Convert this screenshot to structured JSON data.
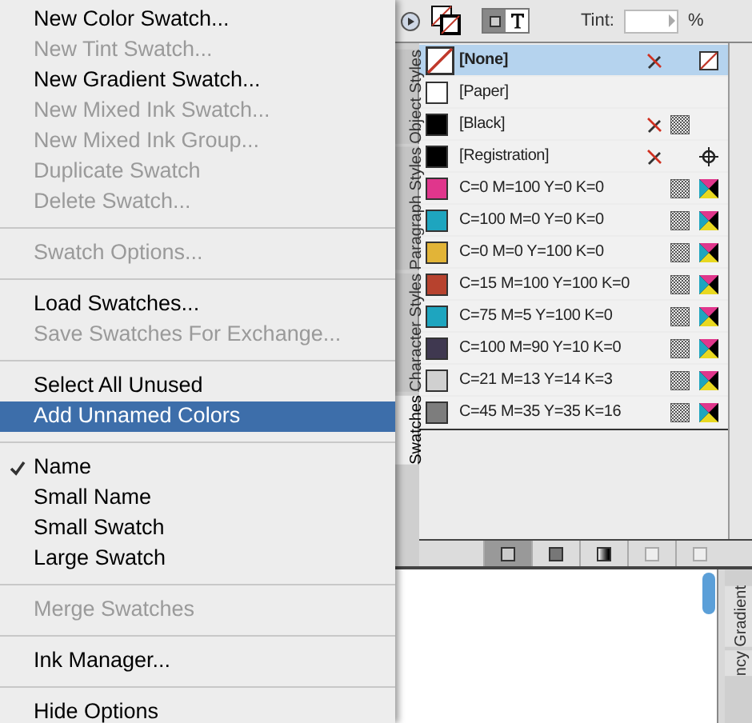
{
  "menu": {
    "sections": [
      [
        {
          "label": "New Color Swatch...",
          "disabled": false,
          "selected": false,
          "checked": false
        },
        {
          "label": "New Tint Swatch...",
          "disabled": true,
          "selected": false,
          "checked": false
        },
        {
          "label": "New Gradient Swatch...",
          "disabled": false,
          "selected": false,
          "checked": false
        },
        {
          "label": "New Mixed Ink Swatch...",
          "disabled": true,
          "selected": false,
          "checked": false
        },
        {
          "label": "New Mixed Ink Group...",
          "disabled": true,
          "selected": false,
          "checked": false
        },
        {
          "label": "Duplicate Swatch",
          "disabled": true,
          "selected": false,
          "checked": false
        },
        {
          "label": "Delete Swatch...",
          "disabled": true,
          "selected": false,
          "checked": false
        }
      ],
      [
        {
          "label": "Swatch Options...",
          "disabled": true,
          "selected": false,
          "checked": false
        }
      ],
      [
        {
          "label": "Load Swatches...",
          "disabled": false,
          "selected": false,
          "checked": false
        },
        {
          "label": "Save Swatches For Exchange...",
          "disabled": true,
          "selected": false,
          "checked": false
        }
      ],
      [
        {
          "label": "Select All Unused",
          "disabled": false,
          "selected": false,
          "checked": false
        },
        {
          "label": "Add Unnamed Colors",
          "disabled": false,
          "selected": true,
          "checked": false
        }
      ],
      [
        {
          "label": "Name",
          "disabled": false,
          "selected": false,
          "checked": true
        },
        {
          "label": "Small Name",
          "disabled": false,
          "selected": false,
          "checked": false
        },
        {
          "label": "Small Swatch",
          "disabled": false,
          "selected": false,
          "checked": false
        },
        {
          "label": "Large Swatch",
          "disabled": false,
          "selected": false,
          "checked": false
        }
      ],
      [
        {
          "label": "Merge Swatches",
          "disabled": true,
          "selected": false,
          "checked": false
        }
      ],
      [
        {
          "label": "Ink Manager...",
          "disabled": false,
          "selected": false,
          "checked": false
        }
      ],
      [
        {
          "label": "Hide Options",
          "disabled": false,
          "selected": false,
          "checked": false
        }
      ]
    ]
  },
  "panel": {
    "side_tabs": [
      {
        "label": "Object Styles",
        "selected": false
      },
      {
        "label": "Paragraph Styles",
        "selected": false
      },
      {
        "label": "Character Styles",
        "selected": false
      },
      {
        "label": "Swatches",
        "selected": true
      }
    ],
    "tint": {
      "label": "Tint:",
      "unit": "%"
    },
    "swatches": [
      {
        "name": "[None]",
        "kind": "none",
        "selected": true
      },
      {
        "name": "[Paper]",
        "kind": "paper",
        "color": "#ffffff",
        "selected": false
      },
      {
        "name": "[Black]",
        "kind": "black",
        "color": "#000000",
        "selected": false
      },
      {
        "name": "[Registration]",
        "kind": "registration",
        "color": "#000000",
        "selected": false
      },
      {
        "name": "C=0 M=100 Y=0 K=0",
        "kind": "process",
        "color": "#e0368c",
        "selected": false
      },
      {
        "name": "C=100 M=0 Y=0 K=0",
        "kind": "process",
        "color": "#1ea5bf",
        "selected": false
      },
      {
        "name": "C=0 M=0 Y=100 K=0",
        "kind": "process",
        "color": "#e2b437",
        "selected": false
      },
      {
        "name": "C=15 M=100 Y=100 K=0",
        "kind": "process",
        "color": "#b7422e",
        "selected": false
      },
      {
        "name": "C=75 M=5 Y=100 K=0",
        "kind": "process",
        "color": "#1ea5bf",
        "selected": false
      },
      {
        "name": "C=100 M=90 Y=10 K=0",
        "kind": "process",
        "color": "#3f3850",
        "selected": false
      },
      {
        "name": "C=21 M=13 Y=14 K=3",
        "kind": "process",
        "color": "#d0d0d0",
        "selected": false
      },
      {
        "name": "C=45 M=35 Y=35 K=16",
        "kind": "process",
        "color": "#7d7d7d",
        "selected": false
      }
    ]
  },
  "lower_panel": {
    "side_tabs": [
      {
        "label": "Gradient"
      },
      {
        "label": "ncy"
      }
    ]
  }
}
